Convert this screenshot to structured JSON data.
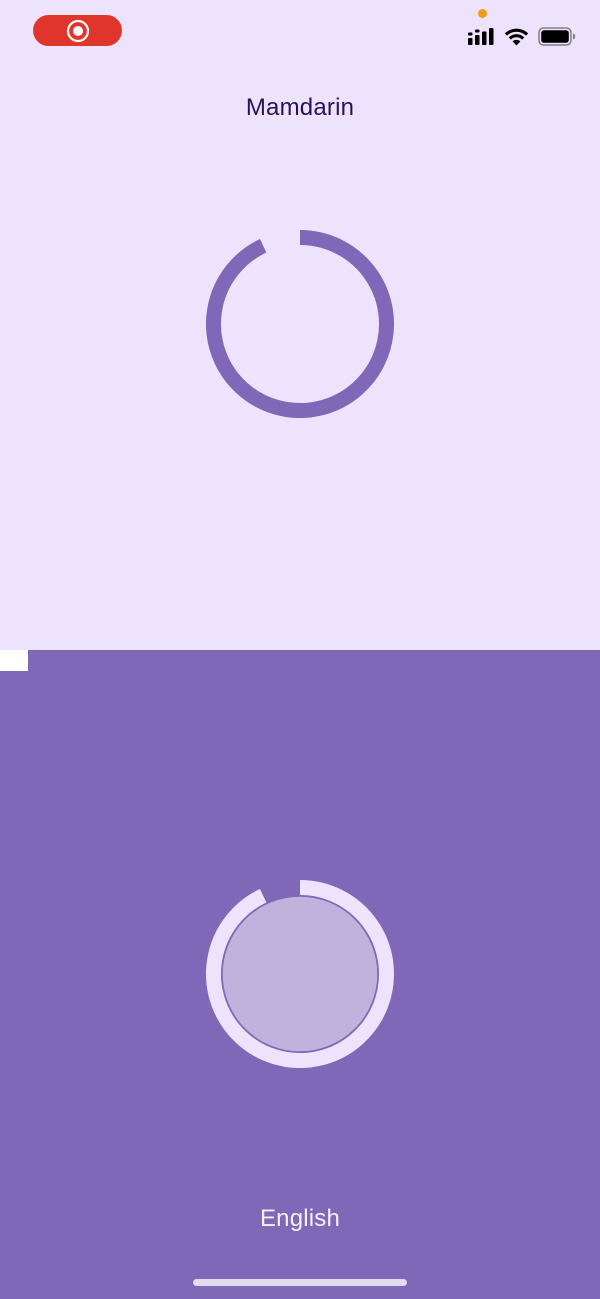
{
  "status_bar": {
    "record_icon": "screen-record-icon",
    "signal_icon": "cellular-signal-icon",
    "wifi_icon": "wifi-icon",
    "battery_icon": "battery-icon",
    "battery_level": 1.0
  },
  "top_pane": {
    "language": "Mamdarin",
    "mic_icon": "mic-ring-icon",
    "ring_progress": 0.93
  },
  "bottom_pane": {
    "language": "English",
    "mic_icon": "mic-ring-icon",
    "ring_progress": 0.93
  },
  "colors": {
    "top_background": "#EEE3FC",
    "bottom_background": "#7E68B7",
    "accent_purple": "#7E68B7",
    "top_text": "#2A1159",
    "bottom_text": "#F6F0FE",
    "ring_light": "#EEE3FC",
    "inner_disc": "#C0B2DC",
    "record_red": "#E0352B",
    "privacy_orange": "#F29B16",
    "home_indicator": "#E3DCEC"
  }
}
